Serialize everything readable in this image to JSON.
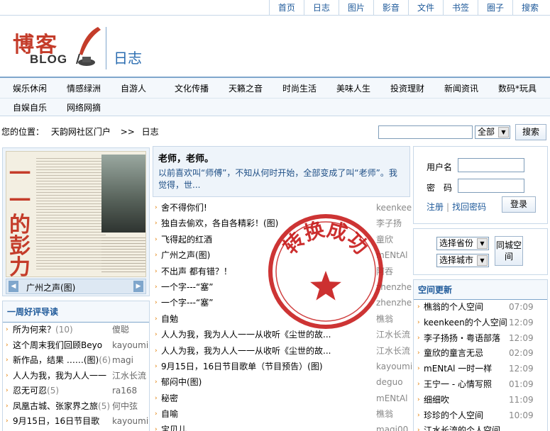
{
  "top_nav": [
    "首页",
    "日志",
    "图片",
    "影音",
    "文件",
    "书签",
    "圈子",
    "搜索"
  ],
  "header": {
    "logo_main": "博客",
    "logo_sub": "BLOG",
    "title": "日志"
  },
  "categories": {
    "row1": [
      "娱乐休闲",
      "情感绿洲",
      "自游人",
      "文化传播",
      "天籁之音",
      "时尚生活",
      "美味人生",
      "投资理财",
      "新闻资讯",
      "数码*玩具"
    ],
    "row2": [
      "自娱自乐",
      "网络网摘"
    ]
  },
  "breadcrumb": {
    "label": "您的位置：",
    "home": "天韵网社区门户",
    "separator": ">>",
    "current": "日志"
  },
  "search": {
    "scope": "全部",
    "button": "搜索"
  },
  "featured": {
    "caption": "广州之声(图)",
    "image_chars": [
      "一",
      "的",
      "彭",
      "力"
    ]
  },
  "weekly": {
    "heading": "一周好评导读",
    "items": [
      {
        "title": "所为何来？",
        "count": "(10)",
        "author": "傻聪"
      },
      {
        "title": "这个周末我们回顾Beyo",
        "count": "",
        "author": "kayoumi"
      },
      {
        "title": "新作品，结果 ……(图)",
        "count": "(6)",
        "author": "magi"
      },
      {
        "title": "人人为我，我为人人一一",
        "count": "",
        "author": "江水长流"
      },
      {
        "title": "忍无可忍",
        "count": "(5)",
        "author": "ra168"
      },
      {
        "title": "凤凰古城、张家界之旅",
        "count": "(5)",
        "author": "何中弦"
      },
      {
        "title": "9月15日，16日节目歌",
        "count": "",
        "author": "kayoumi"
      }
    ]
  },
  "intro": {
    "title": "老师，老师。",
    "body": "以前喜欢叫“师傅”，不知从何时开始，全部变成了叫“老师”。我觉得，世..."
  },
  "posts": [
    {
      "title": "舍不得你们!",
      "author": "keenkee"
    },
    {
      "title": "独自去偷欢，各自各精彩！(图)",
      "author": "李子扬"
    },
    {
      "title": "飞得起的红酒",
      "author": "童欣"
    },
    {
      "title": "广州之声(图)",
      "author": "mENtAl"
    },
    {
      "title": "不出声 都有错？！",
      "author": "阿吞"
    },
    {
      "title": "一个字---“塞”",
      "author": "zhenzhe"
    },
    {
      "title": "一个字---“塞”",
      "author": "zhenzhe"
    },
    {
      "title": "自勉",
      "author": "樵翁"
    },
    {
      "title": "人人为我，我为人人一一从收听《尘世的故...",
      "author": "江水长流"
    },
    {
      "title": "人人为我，我为人人一一从收听《尘世的故...",
      "author": "江水长流"
    },
    {
      "title": "9月15日，16日节目歌单（节目预告）(图)",
      "author": "kayoumi"
    },
    {
      "title": "郁闷中(图)",
      "author": "deguo"
    },
    {
      "title": "秘密",
      "author": "mENtAl"
    },
    {
      "title": "自喻",
      "author": "樵翁"
    },
    {
      "title": "宝贝儿",
      "author": "magi00"
    }
  ],
  "stamp": {
    "text": "转换成功",
    "color": "#c81e1e"
  },
  "login": {
    "username_label": "用户名",
    "password_label": "密　码",
    "register": "注册",
    "separator": "|",
    "forgot": "找回密码",
    "button": "登录"
  },
  "city": {
    "province": "选择省份",
    "city": "选择城市",
    "button": "同城空间"
  },
  "updates": {
    "heading": "空间更新",
    "items": [
      {
        "title": "樵翁的个人空间",
        "time": "07:09"
      },
      {
        "title": "keenkeen的个人空间",
        "time": "12:09"
      },
      {
        "title": "李子扬扬・粤语部落",
        "time": "12:09"
      },
      {
        "title": "童欣的童言无忌",
        "time": "02:09"
      },
      {
        "title": "mENtAl 一时一样",
        "time": "12:09"
      },
      {
        "title": "王宁一 - 心情写照",
        "time": "01:09"
      },
      {
        "title": "细细吹",
        "time": "11:09"
      },
      {
        "title": "珍珍的个人空间",
        "time": "10:09"
      },
      {
        "title": "江水长流的个人空间",
        "time": ""
      }
    ]
  },
  "colors": {
    "accent": "#1f5a9a",
    "border": "#c8d8e8",
    "panel_bg": "#eef4fa",
    "bullet": "#e07b00",
    "logo_red": "#c43c2a"
  }
}
